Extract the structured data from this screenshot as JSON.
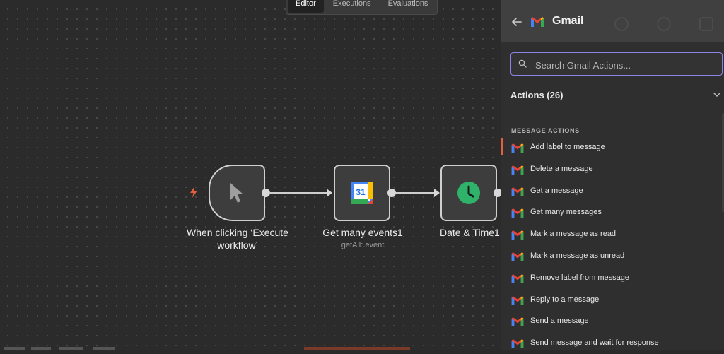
{
  "canvas": {
    "tabs": [
      {
        "label": "Editor",
        "active": true
      },
      {
        "label": "Executions",
        "active": false
      },
      {
        "label": "Evaluations",
        "active": false
      }
    ],
    "nodes": [
      {
        "title_line1": "When clicking ‘Execute",
        "title_line2": "workflow’",
        "subtitle": "",
        "icon": "cursor-pointer-icon"
      },
      {
        "title_line1": "Get many events1",
        "title_line2": "",
        "subtitle": "getAll: event",
        "icon": "google-calendar-icon",
        "calendar_day": "31"
      },
      {
        "title_line1": "Date & Time1",
        "title_line2": "",
        "subtitle": "",
        "icon": "clock-icon"
      }
    ]
  },
  "panel": {
    "title": "Gmail",
    "search": {
      "placeholder": "Search Gmail Actions...",
      "value": ""
    },
    "actions_header": "Actions (26)",
    "section_label": "MESSAGE ACTIONS",
    "actions": [
      "Add label to message",
      "Delete a message",
      "Get a message",
      "Get many messages",
      "Mark a message as read",
      "Mark a message as unread",
      "Remove label from message",
      "Reply to a message",
      "Send a message",
      "Send message and wait for response"
    ]
  },
  "colors": {
    "accent": "#8b84e6",
    "trigger_bolt": "#e2603e",
    "clock_green": "#2fb36a"
  }
}
